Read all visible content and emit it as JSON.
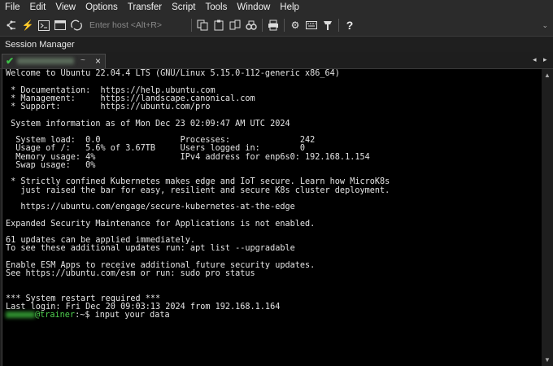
{
  "menu": [
    "File",
    "Edit",
    "View",
    "Options",
    "Transfer",
    "Script",
    "Tools",
    "Window",
    "Help"
  ],
  "toolbar": {
    "host_placeholder": "Enter host <Alt+R>",
    "icons_left": [
      "connect-icon",
      "quick-connect-icon",
      "terminal-icon",
      "window-icon",
      "reconnect-icon"
    ],
    "icons_right": [
      "copy-icon",
      "paste-icon",
      "find-icon",
      "print-icon",
      "settings-icon",
      "keymap-icon",
      "script-icon",
      "help-icon"
    ]
  },
  "session_manager": {
    "title": "Session Manager"
  },
  "tab": {
    "label_dropdown": "~",
    "close": "×"
  },
  "terminal": {
    "lines": [
      "Welcome to Ubuntu 22.04.4 LTS (GNU/Linux 5.15.0-112-generic x86_64)",
      "",
      " * Documentation:  https://help.ubuntu.com",
      " * Management:     https://landscape.canonical.com",
      " * Support:        https://ubuntu.com/pro",
      "",
      " System information as of Mon Dec 23 02:09:47 AM UTC 2024",
      "",
      "  System load:  0.0                Processes:              242",
      "  Usage of /:   5.6% of 3.67TB     Users logged in:        0",
      "  Memory usage: 4%                 IPv4 address for enp6s0: 192.168.1.154",
      "  Swap usage:   0%",
      "",
      " * Strictly confined Kubernetes makes edge and IoT secure. Learn how MicroK8s",
      "   just raised the bar for easy, resilient and secure K8s cluster deployment.",
      "",
      "   https://ubuntu.com/engage/secure-kubernetes-at-the-edge",
      "",
      "Expanded Security Maintenance for Applications is not enabled.",
      "",
      "61 updates can be applied immediately.",
      "To see these additional updates run: apt list --upgradable",
      "",
      "Enable ESM Apps to receive additional future security updates.",
      "See https://ubuntu.com/esm or run: sudo pro status",
      "",
      "",
      "*** System restart required ***",
      "Last login: Fri Dec 20 09:03:13 2024 from 192.168.1.164"
    ],
    "prompt_host": "@trainer",
    "prompt_path": ":~$ ",
    "command": "input your data"
  }
}
